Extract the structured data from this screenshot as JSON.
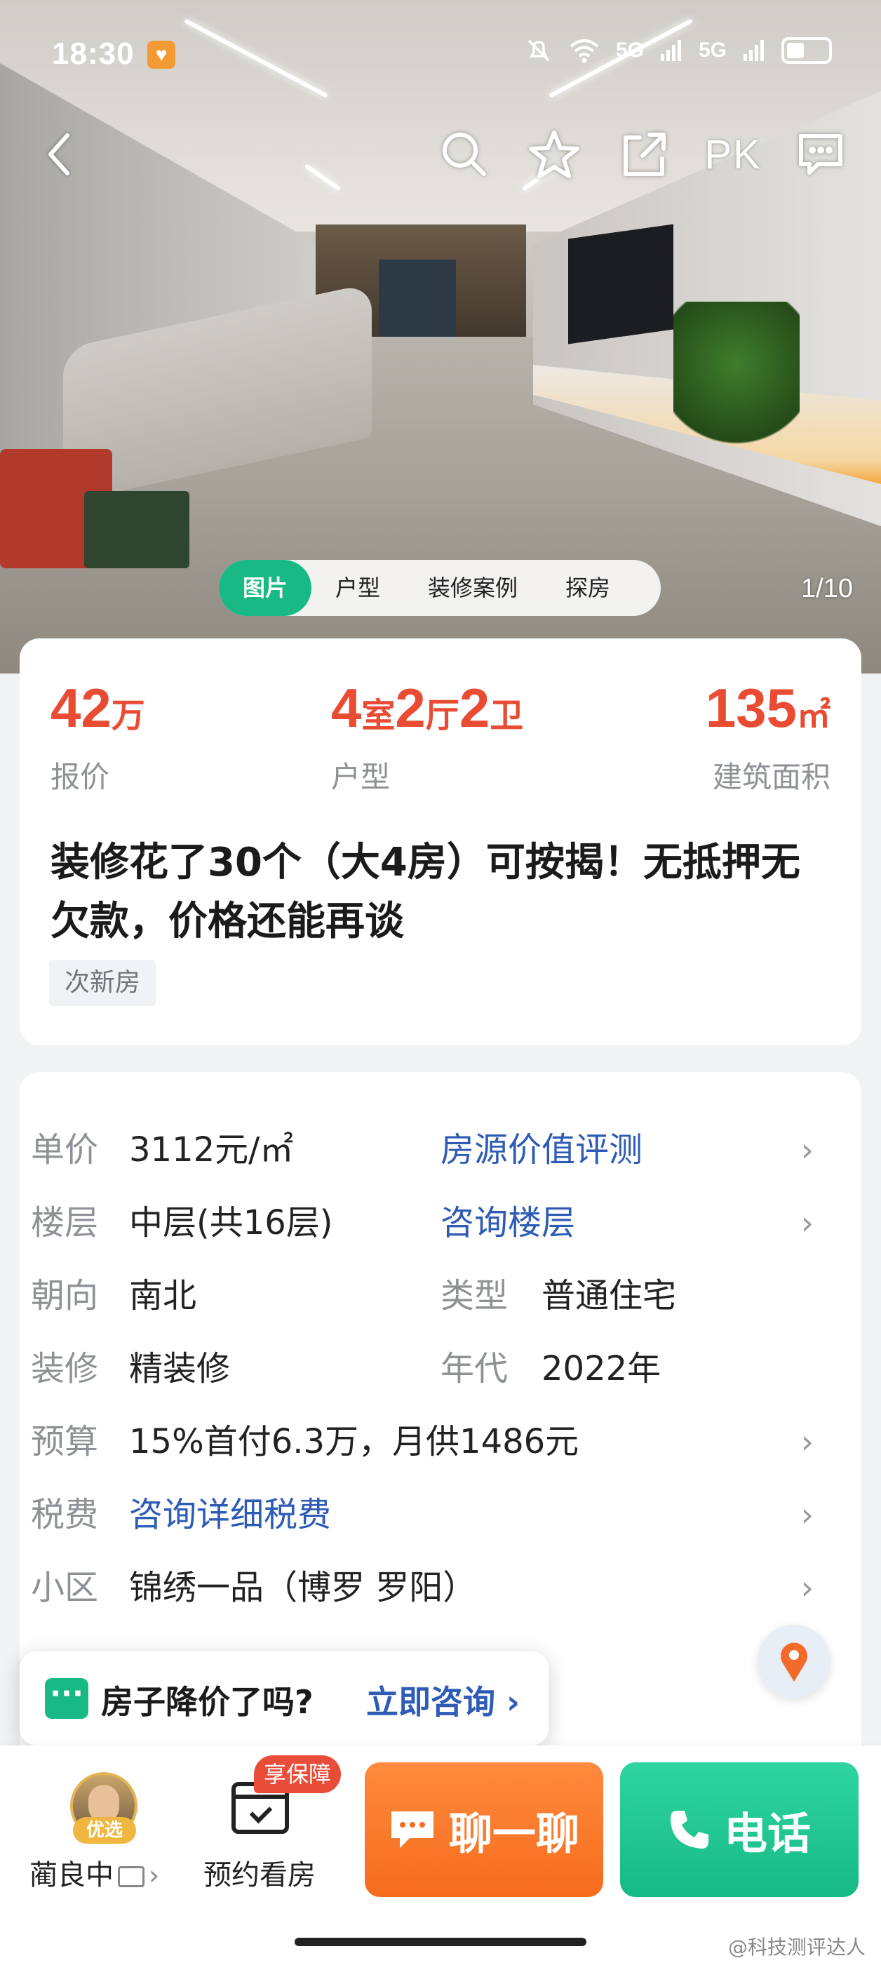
{
  "status_bar": {
    "time": "18:30",
    "signal1": "5G",
    "signal2": "5G"
  },
  "top_nav": {
    "pk_label": "PK"
  },
  "photo": {
    "tabs": [
      "图片",
      "户型",
      "装修案例",
      "探房"
    ],
    "active_tab": "图片",
    "counter": "1/10"
  },
  "summary": {
    "price_num": "42",
    "price_unit": "万",
    "price_label": "报价",
    "layout_parts": [
      "4",
      "室",
      "2",
      "厅",
      "2",
      "卫"
    ],
    "layout_label": "户型",
    "area_num": "135",
    "area_unit": "㎡",
    "area_label": "建筑面积",
    "title": "装修花了30个（大4房）可按揭！无抵押无欠款，价格还能再谈",
    "tag": "次新房"
  },
  "details": {
    "unit_price_label": "单价",
    "unit_price_value": "3112元/㎡",
    "value_eval_link": "房源价值评测",
    "floor_label": "楼层",
    "floor_value": "中层(共16层)",
    "floor_link": "咨询楼层",
    "orientation_label": "朝向",
    "orientation_value": "南北",
    "type_label": "类型",
    "type_value": "普通住宅",
    "decor_label": "装修",
    "decor_value": "精装修",
    "year_label": "年代",
    "year_value": "2022年",
    "budget_label": "预算",
    "budget_value": "15%首付6.3万，月供1486元",
    "tax_label": "税费",
    "tax_link": "咨询详细税费",
    "community_label": "小区",
    "community_value": "锦绣一品（博罗 罗阳）"
  },
  "tooltip": {
    "question": "房子降价了吗?",
    "link": "立即咨询"
  },
  "bottom_bar": {
    "agent_name": "蔺良中",
    "agent_badge": "优选",
    "visit_label": "预约看房",
    "guarantee_badge": "享保障",
    "chat_label": "聊一聊",
    "call_label": "电话"
  },
  "watermark": "@科技测评达人",
  "colors": {
    "accent_green": "#18b984",
    "price_red": "#e94b33",
    "link_blue": "#2d5bb5",
    "chat_orange": "#f66c1d"
  }
}
